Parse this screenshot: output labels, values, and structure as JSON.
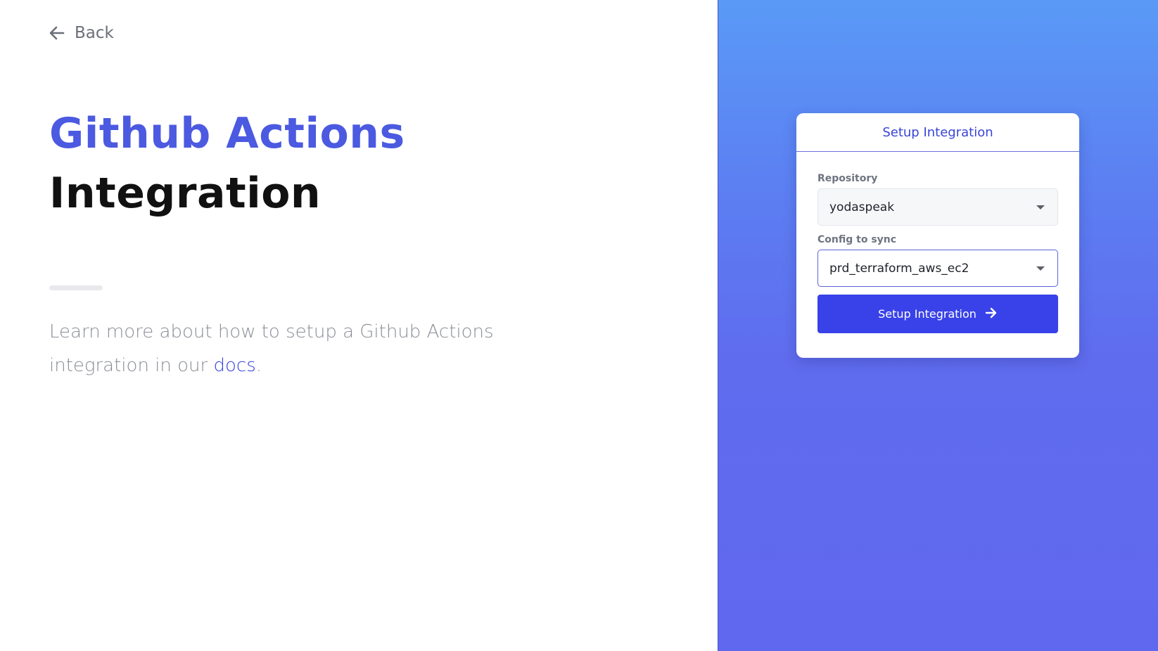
{
  "nav": {
    "back_label": "Back",
    "back_icon": "arrow-left-icon"
  },
  "hero": {
    "title_line1": "Github Actions",
    "title_line2": "Integration",
    "description_prefix": "Learn more about how to setup a Github Actions integration in our ",
    "docs_link": "docs",
    "description_suffix": "."
  },
  "card": {
    "header": "Setup Integration",
    "repository": {
      "label": "Repository",
      "value": "yodaspeak"
    },
    "config": {
      "label": "Config to sync",
      "value": "prd_terraform_aws_ec2"
    },
    "submit_label": "Setup Integration",
    "submit_icon": "arrow-right-icon"
  },
  "colors": {
    "accent": "#4b5ae0",
    "button": "#3942e8",
    "panel_gradient_top": "#5a9af6",
    "panel_gradient_bottom": "#6068ef"
  }
}
